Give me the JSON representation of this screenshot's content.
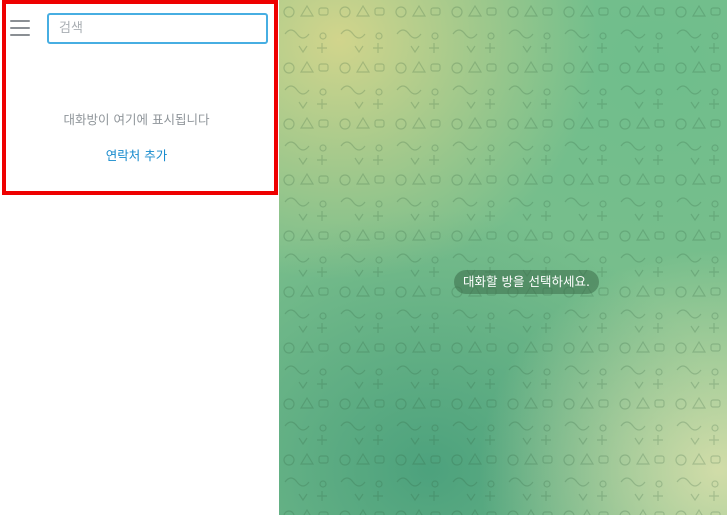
{
  "sidebar": {
    "menu_icon": "hamburger-menu-icon",
    "search": {
      "placeholder": "검색",
      "value": ""
    },
    "empty_state": {
      "message": "대화방이 여기에 표시됩니다",
      "add_contact_label": "연락처 추가"
    }
  },
  "chat": {
    "placeholder_message": "대화할 방을 선택하세요."
  },
  "colors": {
    "highlight_border": "#ee0000",
    "search_border": "#47aee2",
    "link": "#168acd",
    "muted_text": "#8f959a"
  }
}
